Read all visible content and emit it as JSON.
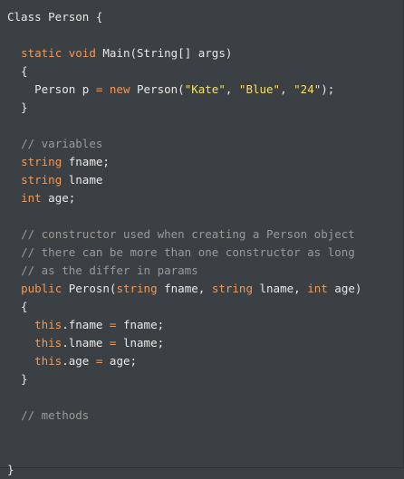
{
  "colors": {
    "background": "#3b4044",
    "keyword": "#ea9a61",
    "string": "#f4df6e",
    "comment": "#9a9a9a",
    "plain": "#e8e8e8"
  },
  "code": {
    "lines": [
      [
        {
          "t": "pl",
          "v": "Class Person {"
        }
      ],
      [],
      [
        {
          "t": "pl",
          "v": "  "
        },
        {
          "t": "kw",
          "v": "static"
        },
        {
          "t": "pl",
          "v": " "
        },
        {
          "t": "kw",
          "v": "void"
        },
        {
          "t": "pl",
          "v": " Main(String[] args)"
        }
      ],
      [
        {
          "t": "pl",
          "v": "  {"
        }
      ],
      [
        {
          "t": "pl",
          "v": "    Person p "
        },
        {
          "t": "op",
          "v": "="
        },
        {
          "t": "pl",
          "v": " "
        },
        {
          "t": "kw",
          "v": "new"
        },
        {
          "t": "pl",
          "v": " Person("
        },
        {
          "t": "str",
          "v": "\"Kate\""
        },
        {
          "t": "pl",
          "v": ", "
        },
        {
          "t": "str",
          "v": "\"Blue\""
        },
        {
          "t": "pl",
          "v": ", "
        },
        {
          "t": "str",
          "v": "\"24\""
        },
        {
          "t": "pl",
          "v": ");"
        }
      ],
      [
        {
          "t": "pl",
          "v": "  }"
        }
      ],
      [],
      [
        {
          "t": "pl",
          "v": "  "
        },
        {
          "t": "cm",
          "v": "// variables"
        }
      ],
      [
        {
          "t": "pl",
          "v": "  "
        },
        {
          "t": "ty",
          "v": "string"
        },
        {
          "t": "pl",
          "v": " fname;"
        }
      ],
      [
        {
          "t": "pl",
          "v": "  "
        },
        {
          "t": "ty",
          "v": "string"
        },
        {
          "t": "pl",
          "v": " lname"
        }
      ],
      [
        {
          "t": "pl",
          "v": "  "
        },
        {
          "t": "ty",
          "v": "int"
        },
        {
          "t": "pl",
          "v": " age;"
        }
      ],
      [],
      [
        {
          "t": "pl",
          "v": "  "
        },
        {
          "t": "cm",
          "v": "// constructor used when creating a Person object"
        }
      ],
      [
        {
          "t": "pl",
          "v": "  "
        },
        {
          "t": "cm",
          "v": "// there can be more than one constructor as long"
        }
      ],
      [
        {
          "t": "pl",
          "v": "  "
        },
        {
          "t": "cm",
          "v": "// as the differ in params"
        }
      ],
      [
        {
          "t": "pl",
          "v": "  "
        },
        {
          "t": "kw",
          "v": "public"
        },
        {
          "t": "pl",
          "v": " Perosn("
        },
        {
          "t": "ty",
          "v": "string"
        },
        {
          "t": "pl",
          "v": " fname, "
        },
        {
          "t": "ty",
          "v": "string"
        },
        {
          "t": "pl",
          "v": " lname, "
        },
        {
          "t": "ty",
          "v": "int"
        },
        {
          "t": "pl",
          "v": " age)"
        }
      ],
      [
        {
          "t": "pl",
          "v": "  {"
        }
      ],
      [
        {
          "t": "pl",
          "v": "    "
        },
        {
          "t": "kw",
          "v": "this"
        },
        {
          "t": "pl",
          "v": ".fname "
        },
        {
          "t": "op",
          "v": "="
        },
        {
          "t": "pl",
          "v": " fname;"
        }
      ],
      [
        {
          "t": "pl",
          "v": "    "
        },
        {
          "t": "kw",
          "v": "this"
        },
        {
          "t": "pl",
          "v": ".lname "
        },
        {
          "t": "op",
          "v": "="
        },
        {
          "t": "pl",
          "v": " lname;"
        }
      ],
      [
        {
          "t": "pl",
          "v": "    "
        },
        {
          "t": "kw",
          "v": "this"
        },
        {
          "t": "pl",
          "v": ".age "
        },
        {
          "t": "op",
          "v": "="
        },
        {
          "t": "pl",
          "v": " age;"
        }
      ],
      [
        {
          "t": "pl",
          "v": "  }"
        }
      ],
      [],
      [
        {
          "t": "pl",
          "v": "  "
        },
        {
          "t": "cm",
          "v": "// methods"
        }
      ],
      [],
      [],
      [
        {
          "t": "pl",
          "v": "}"
        }
      ]
    ]
  }
}
